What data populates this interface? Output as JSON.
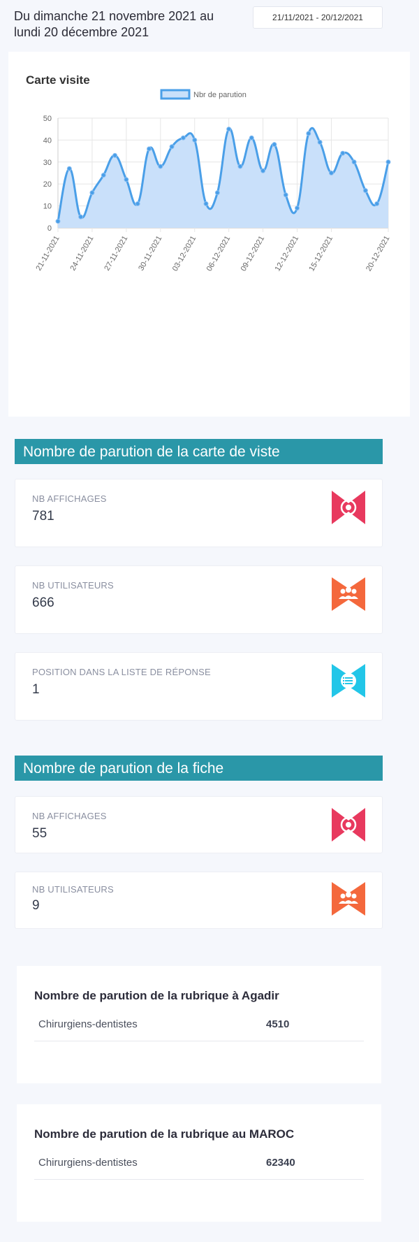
{
  "header": {
    "date_title": "Du dimanche 21 novembre 2021 au lundi 20 décembre 2021",
    "date_range": "21/11/2021 - 20/12/2021"
  },
  "chart_card": {
    "title": "Carte visite"
  },
  "chart_data": {
    "type": "area",
    "title": "Carte visite",
    "xlabel": "",
    "ylabel": "",
    "ylim": [
      0,
      50
    ],
    "yticks": [
      0,
      10,
      20,
      30,
      40,
      50
    ],
    "grid": true,
    "legend_position": "top",
    "x": [
      "21-11-2021",
      "22-11-2021",
      "23-11-2021",
      "24-11-2021",
      "25-11-2021",
      "26-11-2021",
      "27-11-2021",
      "28-11-2021",
      "29-11-2021",
      "30-11-2021",
      "01-12-2021",
      "02-12-2021",
      "03-12-2021",
      "04-12-2021",
      "05-12-2021",
      "06-12-2021",
      "07-12-2021",
      "08-12-2021",
      "09-12-2021",
      "10-12-2021",
      "11-12-2021",
      "12-12-2021",
      "13-12-2021",
      "14-12-2021",
      "15-12-2021",
      "16-12-2021",
      "17-12-2021",
      "18-12-2021",
      "19-12-2021",
      "20-12-2021"
    ],
    "x_tick_labels": [
      "21-11-2021",
      "24-11-2021",
      "27-11-2021",
      "30-11-2021",
      "03-12-2021",
      "06-12-2021",
      "09-12-2021",
      "12-12-2021",
      "15-12-2021",
      "20-12-2021"
    ],
    "series": [
      {
        "name": "Nbr de parution",
        "color": "#4a9fe8",
        "fill": "#c9e0fa",
        "values": [
          3,
          27,
          5,
          16,
          24,
          33,
          22,
          11,
          36,
          28,
          37,
          41,
          40,
          11,
          16,
          45,
          28,
          41,
          26,
          38,
          15,
          9,
          43,
          39,
          25,
          34,
          30,
          17,
          11,
          30
        ]
      }
    ]
  },
  "section_visit": {
    "title": "Nombre de parution de la carte de viste",
    "stats": [
      {
        "label": "NB AFFICHAGES",
        "value": "781",
        "icon": "eye-icon",
        "color": "#e8395e"
      },
      {
        "label": "NB UTILISATEURS",
        "value": "666",
        "icon": "users-icon",
        "color": "#f4683c"
      },
      {
        "label": "POSITION DANS LA LISTE DE RÉPONSE",
        "value": "1",
        "icon": "list-icon",
        "color": "#22c6e8"
      }
    ]
  },
  "section_fiche": {
    "title": "Nombre de parution de la fiche",
    "stats": [
      {
        "label": "NB AFFICHAGES",
        "value": "55",
        "icon": "eye-icon",
        "color": "#e8395e"
      },
      {
        "label": "NB UTILISATEURS",
        "value": "9",
        "icon": "users-icon",
        "color": "#f4683c"
      }
    ]
  },
  "rubric_agadir": {
    "title": "Nombre de parution de la rubrique à Agadir",
    "rows": [
      {
        "name": "Chirurgiens-dentistes",
        "count": "4510"
      }
    ]
  },
  "rubric_maroc": {
    "title": "Nombre de parution de la rubrique au MAROC",
    "rows": [
      {
        "name": "Chirurgiens-dentistes",
        "count": "62340"
      }
    ]
  }
}
